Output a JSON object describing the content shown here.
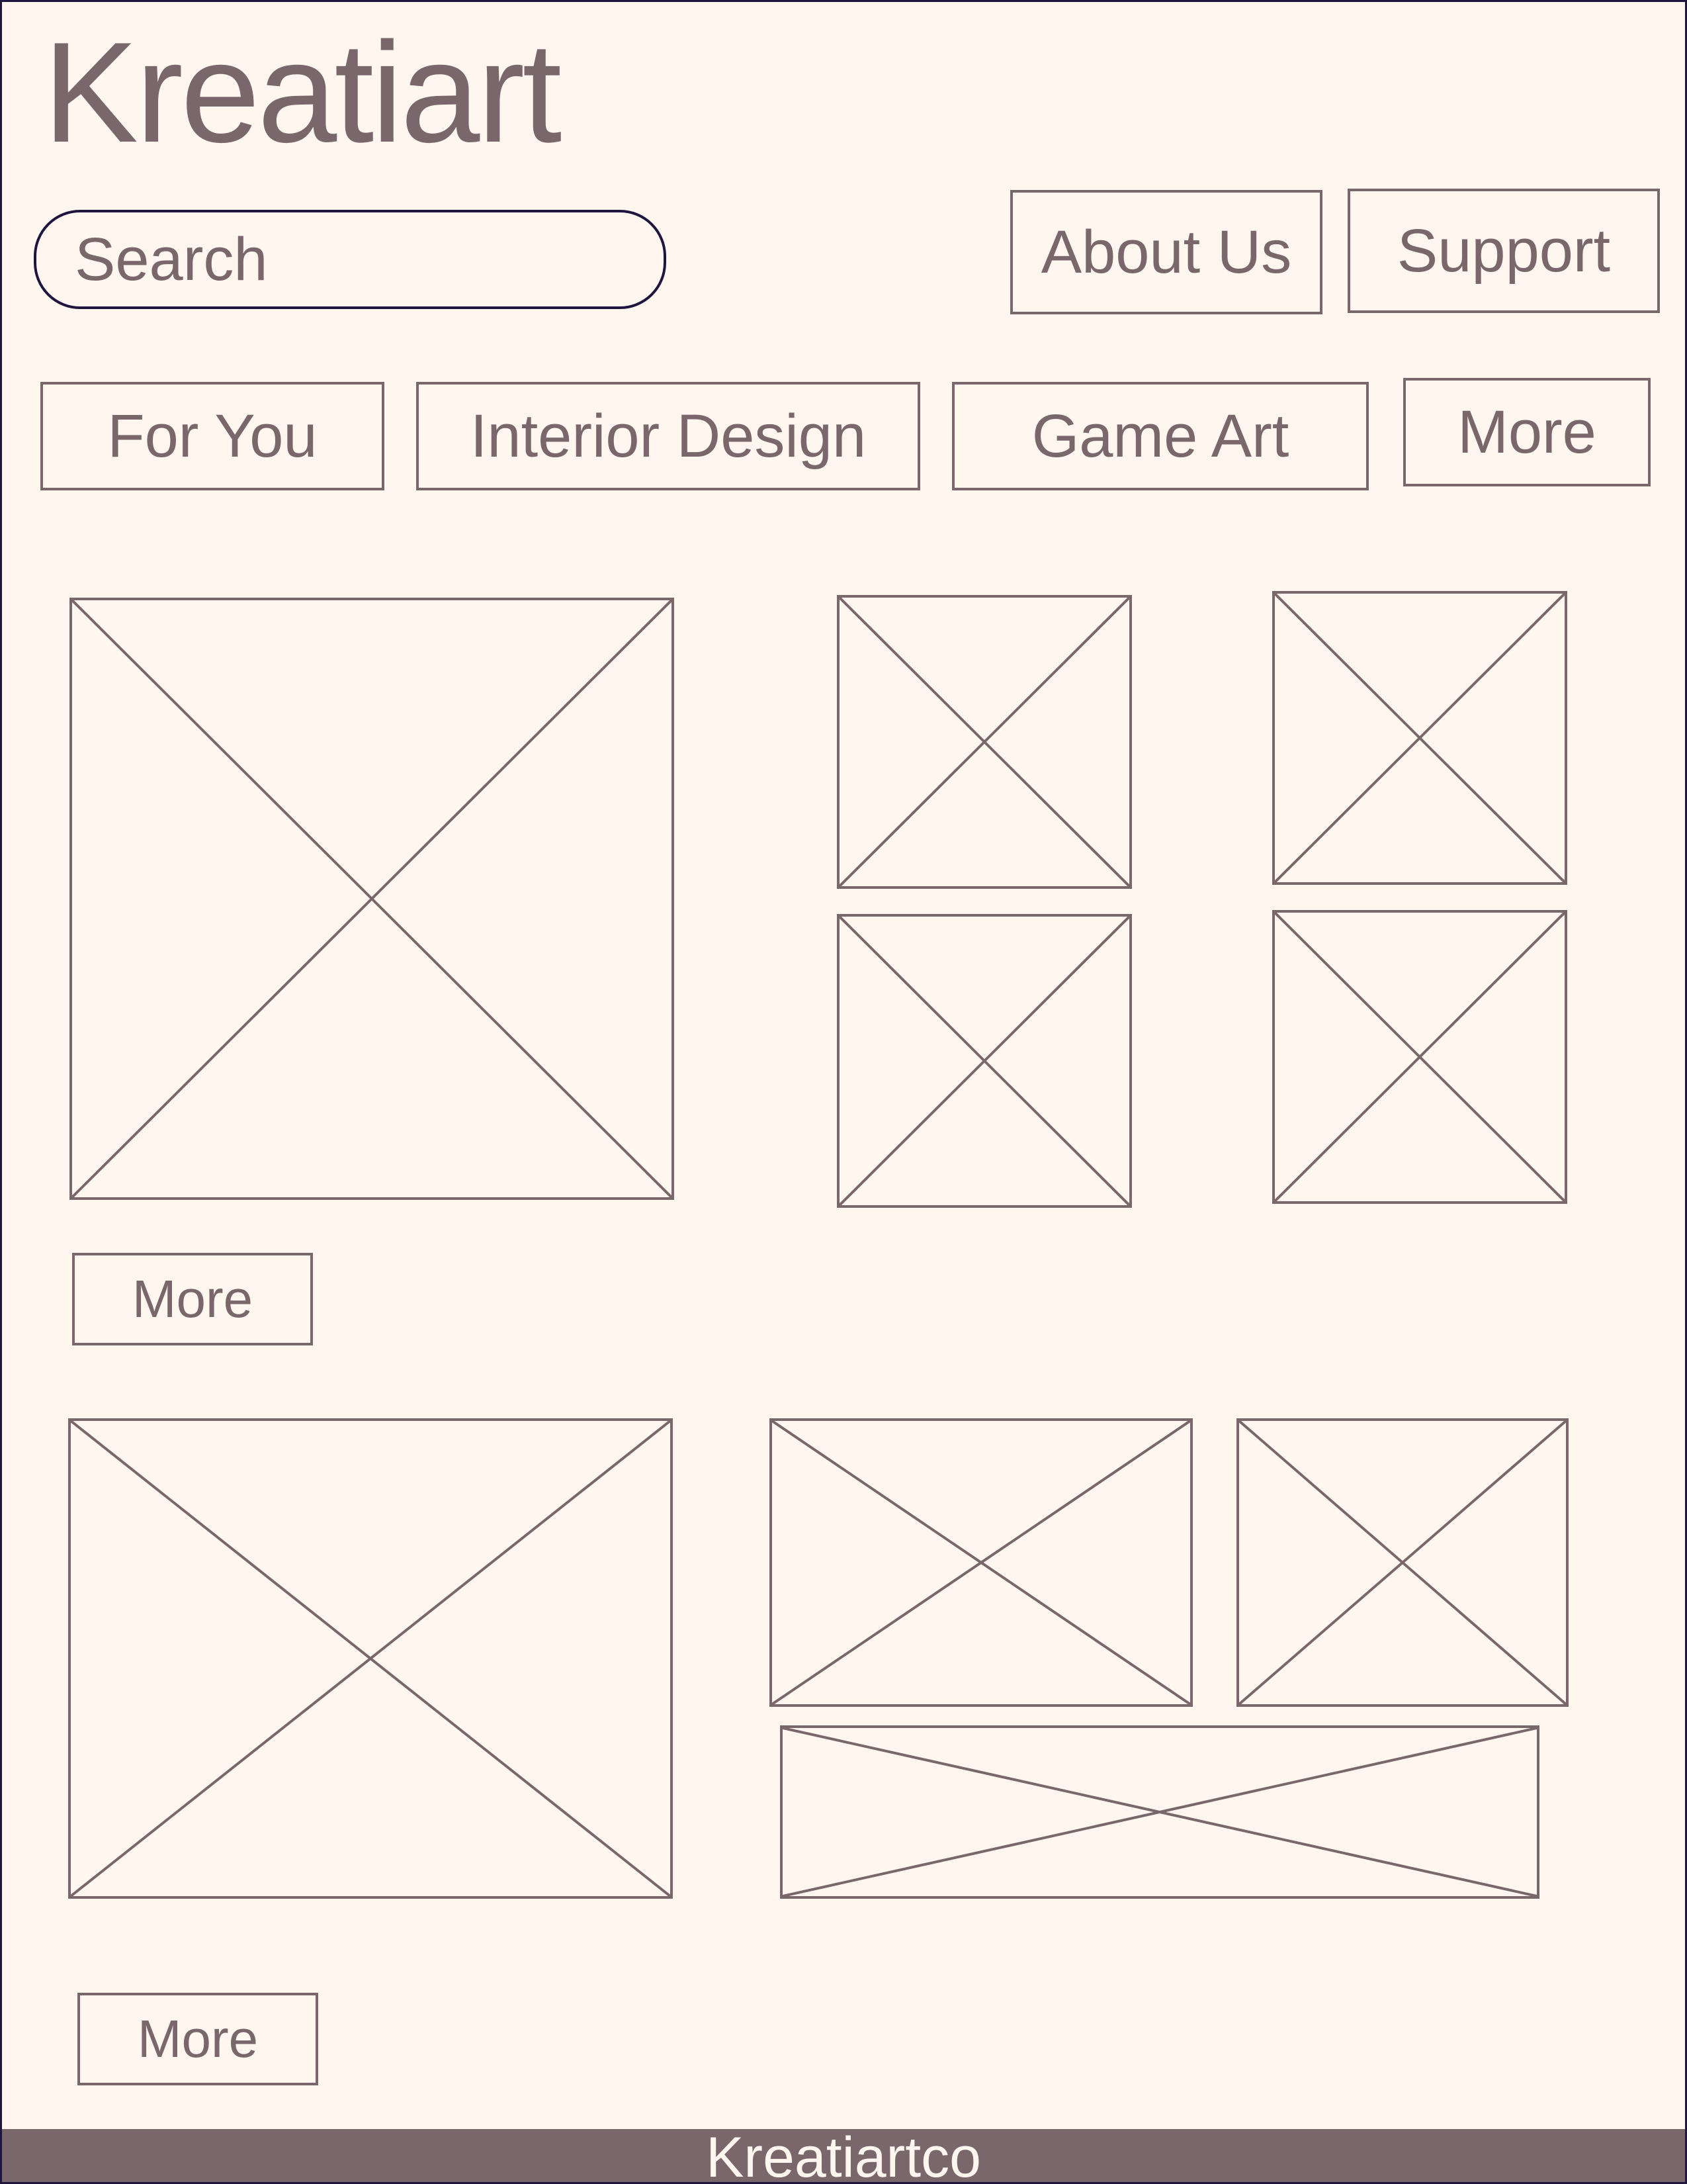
{
  "header": {
    "logo_text": "Kreatiart",
    "search": {
      "placeholder": "Search",
      "value": ""
    },
    "links": {
      "about": "About Us",
      "support": "Support"
    }
  },
  "categories": [
    {
      "label": "For You"
    },
    {
      "label": "Interior Design"
    },
    {
      "label": "Game Art"
    },
    {
      "label": "More"
    }
  ],
  "sections": [
    {
      "more_label": "More"
    },
    {
      "more_label": "More"
    }
  ],
  "footer": {
    "text": "Kreatiartco"
  },
  "colors": {
    "background": "#fff6ef",
    "ink": "#7a676c",
    "outline_dark": "#1f1640",
    "footer_bg": "#7a676c",
    "footer_text": "#fff6ef"
  }
}
